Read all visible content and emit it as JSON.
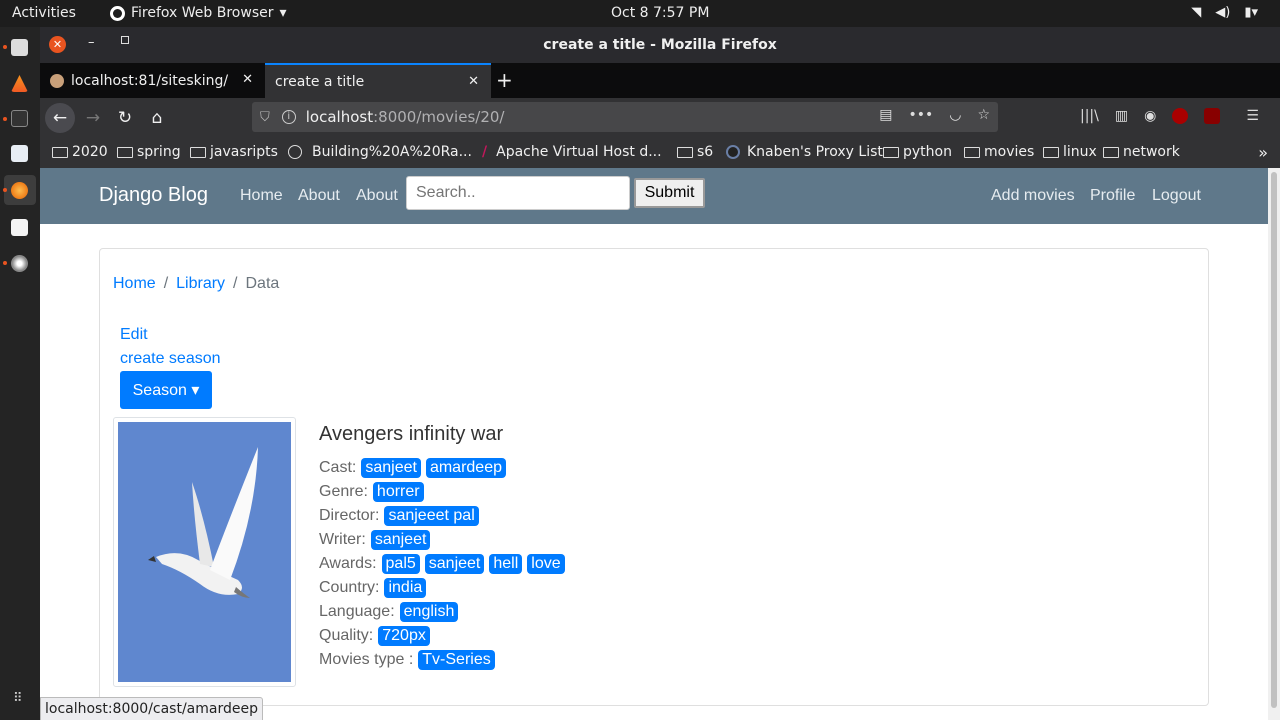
{
  "system": {
    "activities": "Activities",
    "app_name": "Firefox Web Browser",
    "clock": "Oct 8   7:57 PM"
  },
  "window": {
    "title": "create a title - Mozilla Firefox"
  },
  "tabs": [
    {
      "label": "localhost:81/sitesking/",
      "active": false
    },
    {
      "label": "create a title",
      "active": true
    }
  ],
  "url": {
    "host": "localhost",
    "path": ":8000/movies/20/"
  },
  "bookmarks": [
    {
      "label": "2020",
      "icon": "folder-icon"
    },
    {
      "label": "spring",
      "icon": "folder-icon"
    },
    {
      "label": "javasripts",
      "icon": "folder-icon"
    },
    {
      "label": "Building%20A%20Ra...",
      "icon": "globe-icon"
    },
    {
      "label": "Apache Virtual Host d...",
      "icon": "feather-icon"
    },
    {
      "label": "s6",
      "icon": "folder-icon"
    },
    {
      "label": "Knaben's Proxy List",
      "icon": "site-icon"
    },
    {
      "label": "python",
      "icon": "folder-icon"
    },
    {
      "label": "movies",
      "icon": "folder-icon"
    },
    {
      "label": "linux",
      "icon": "folder-icon"
    },
    {
      "label": "network",
      "icon": "folder-icon"
    }
  ],
  "site": {
    "brand": "Django Blog",
    "nav_left": [
      "Home",
      "About",
      "About"
    ],
    "search_placeholder": "Search..",
    "submit_label": "Submit",
    "nav_right": [
      "Add movies",
      "Profile",
      "Logout"
    ]
  },
  "breadcrumb": {
    "home": "Home",
    "library": "Library",
    "current": "Data"
  },
  "actions": {
    "edit": "Edit",
    "create_season": "create season",
    "season_dropdown": "Season"
  },
  "movie": {
    "title": "Avengers infinity war",
    "fields": [
      {
        "label": "Cast:",
        "values": [
          "sanjeet",
          "amardeep"
        ]
      },
      {
        "label": "Genre:",
        "values": [
          "horrer"
        ]
      },
      {
        "label": "Director:",
        "values": [
          "sanjeeet pal"
        ]
      },
      {
        "label": "Writer:",
        "values": [
          "sanjeet"
        ]
      },
      {
        "label": "Awards:",
        "values": [
          "pal5",
          "sanjeet",
          "hell",
          "love"
        ]
      },
      {
        "label": "Country:",
        "values": [
          "india"
        ]
      },
      {
        "label": "Language:",
        "values": [
          "english"
        ]
      },
      {
        "label": "Quality:",
        "values": [
          "720px"
        ]
      },
      {
        "label": "Movies type :",
        "values": [
          "Tv-Series"
        ]
      }
    ]
  },
  "status_url": "localhost:8000/cast/amardeep",
  "colors": {
    "navbar": "#5f788a",
    "primary": "#007bff"
  }
}
